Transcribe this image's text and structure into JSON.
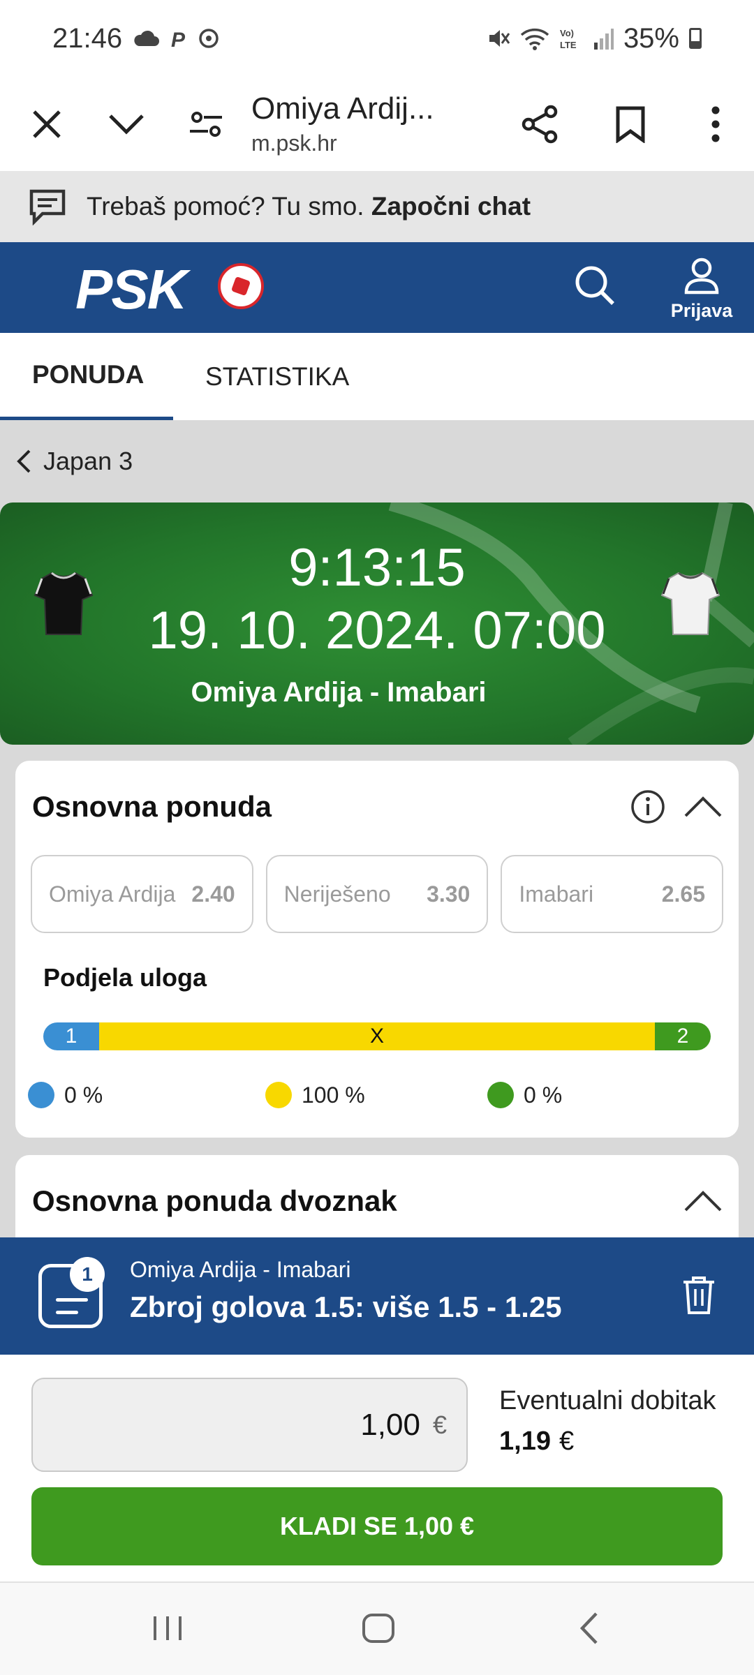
{
  "status_bar": {
    "time": "21:46",
    "battery": "35%"
  },
  "browser": {
    "title": "Omiya Ardij...",
    "url": "m.psk.hr"
  },
  "help": {
    "text": "Trebaš pomoć? Tu smo.",
    "link": "Započni chat"
  },
  "header": {
    "logo": "PSK",
    "login_label": "Prijava"
  },
  "tabs": [
    {
      "label": "PONUDA",
      "active": true
    },
    {
      "label": "STATISTIKA",
      "active": false
    }
  ],
  "breadcrumb": {
    "label": "Japan 3"
  },
  "match": {
    "countdown": "9:13:15",
    "datetime": "19. 10. 2024. 07:00",
    "teams": "Omiya Ardija - Imabari"
  },
  "market_main": {
    "title": "Osnovna ponuda",
    "odds": [
      {
        "label": "Omiya Ardija",
        "value": "2.40"
      },
      {
        "label": "Neriješeno",
        "value": "3.30"
      },
      {
        "label": "Imabari",
        "value": "2.65"
      }
    ],
    "split_title": "Podjela uloga",
    "split": {
      "seg1_label": "1",
      "segx_label": "X",
      "seg2_label": "2",
      "home_pct": "0 %",
      "draw_pct": "100 %",
      "away_pct": "0 %",
      "home_color": "#3a8fd3",
      "draw_color": "#f8d800",
      "away_color": "#3f9a1f"
    }
  },
  "market_double": {
    "title": "Osnovna ponuda dvoznak"
  },
  "bet_slip": {
    "count": "1",
    "match": "Omiya Ardija - Imabari",
    "selection": "Zbroj golova 1.5: više 1.5 - 1.25"
  },
  "stake": {
    "value": "1,00",
    "currency": "€",
    "win_label": "Eventualni dobitak",
    "win_value": "1,19",
    "win_currency": "€",
    "button_label": "KLADI SE 1,00 €"
  },
  "colors": {
    "brand_blue": "#1d4a87",
    "action_green": "#3f9a1f"
  }
}
